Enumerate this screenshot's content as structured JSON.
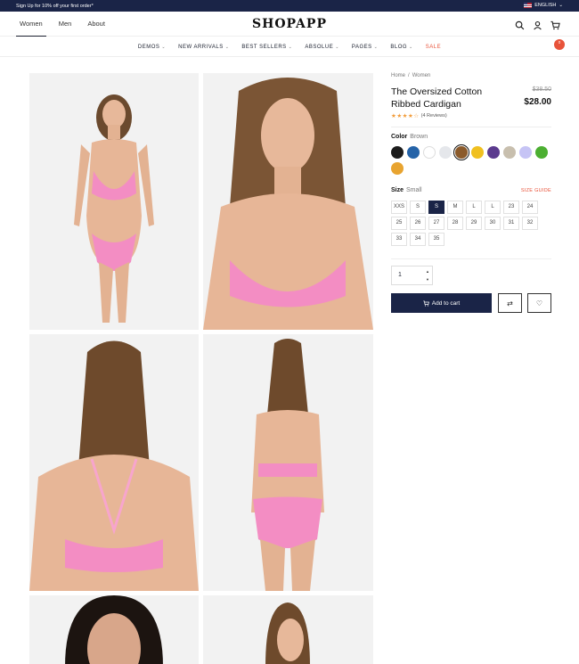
{
  "topbar": {
    "promo": "Sign Up for 10% off your first order*",
    "language": "ENGLISH"
  },
  "header": {
    "gender_tabs": [
      "Women",
      "Men",
      "About"
    ],
    "logo": "SHOPAPP",
    "cart_count": "0"
  },
  "nav": {
    "items": [
      "DEMOS",
      "NEW ARRIVALS",
      "BEST SELLERS",
      "ABSOLUE",
      "PAGES",
      "BLOG",
      "SALE"
    ]
  },
  "product": {
    "breadcrumb": [
      "Home",
      "/",
      "Women"
    ],
    "title": "The Oversized Cotton Ribbed Cardigan",
    "old_price": "$38.50",
    "price": "$28.00",
    "stars": "★★★★☆",
    "reviews": "(4 Reviews)",
    "color_label": "Color",
    "color_value": "Brown",
    "swatches": [
      "#1c1c1c",
      "#2563a8",
      "#ffffff",
      "#e5e7eb",
      "#8b5a2b",
      "#f0c020",
      "#5b3a8e",
      "#c8bfae",
      "#c6c4f5",
      "#4caf32",
      "#e8a430"
    ],
    "selected_swatch": 4,
    "size_label": "Size",
    "size_value": "Small",
    "size_guide": "SIZE GUIDE",
    "sizes": [
      "XXS",
      "S",
      "S",
      "M",
      "L",
      "L",
      "23",
      "24",
      "25",
      "26",
      "27",
      "28",
      "29",
      "30",
      "31",
      "32",
      "33",
      "34",
      "35"
    ],
    "selected_size": 2,
    "quantity": "1",
    "add_to_cart": "Add to cart"
  },
  "icons": {
    "search": "search-icon",
    "account": "user-icon",
    "cart": "cart-icon",
    "compare": "compare-icon",
    "wishlist": "heart-icon"
  }
}
